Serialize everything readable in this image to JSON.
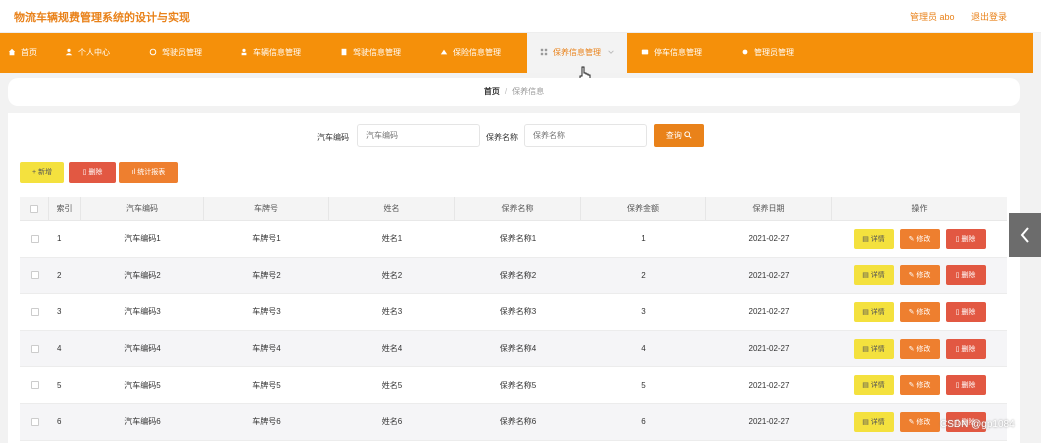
{
  "app": {
    "title": "物流车辆规费管理系统的设计与实现"
  },
  "user": {
    "role_name": "管理员 abo",
    "logout_label": "退出登录"
  },
  "nav": {
    "items": [
      {
        "label": "首页",
        "icon": "home-icon"
      },
      {
        "label": "个人中心",
        "icon": "user-icon"
      },
      {
        "label": "驾驶员管理",
        "icon": "driver-icon"
      },
      {
        "label": "车辆信息管理",
        "icon": "car-icon"
      },
      {
        "label": "驾驶信息管理",
        "icon": "doc-icon"
      },
      {
        "label": "保险信息管理",
        "icon": "insurance-icon"
      },
      {
        "label": "保养信息管理",
        "icon": "grid-icon",
        "active": true
      },
      {
        "label": "停车信息管理",
        "icon": "parking-icon"
      },
      {
        "label": "管理员管理",
        "icon": "admin-icon"
      }
    ]
  },
  "breadcrumb": {
    "home": "首页",
    "separator": "/",
    "current": "保养信息"
  },
  "search": {
    "car_code_label": "汽车编码",
    "car_code_placeholder": "汽车编码",
    "maint_name_label": "保养名称",
    "maint_name_placeholder": "保养名称",
    "query_label": "查询"
  },
  "actions": {
    "add_label": "新增",
    "delete_label": "删除",
    "stats_label": "统计报表"
  },
  "table": {
    "headers": [
      "索引",
      "汽车编码",
      "车牌号",
      "姓名",
      "保养名称",
      "保养金额",
      "保养日期",
      "操作"
    ],
    "rows": [
      {
        "index": "1",
        "car_code": "汽车编码1",
        "plate": "车牌号1",
        "name": "姓名1",
        "maint_name": "保养名称1",
        "amount": "1",
        "date": "2021-02-27"
      },
      {
        "index": "2",
        "car_code": "汽车编码2",
        "plate": "车牌号2",
        "name": "姓名2",
        "maint_name": "保养名称2",
        "amount": "2",
        "date": "2021-02-27"
      },
      {
        "index": "3",
        "car_code": "汽车编码3",
        "plate": "车牌号3",
        "name": "姓名3",
        "maint_name": "保养名称3",
        "amount": "3",
        "date": "2021-02-27"
      },
      {
        "index": "4",
        "car_code": "汽车编码4",
        "plate": "车牌号4",
        "name": "姓名4",
        "maint_name": "保养名称4",
        "amount": "4",
        "date": "2021-02-27"
      },
      {
        "index": "5",
        "car_code": "汽车编码5",
        "plate": "车牌号5",
        "name": "姓名5",
        "maint_name": "保养名称5",
        "amount": "5",
        "date": "2021-02-27"
      },
      {
        "index": "6",
        "car_code": "汽车编码6",
        "plate": "车牌号6",
        "name": "姓名6",
        "maint_name": "保养名称6",
        "amount": "6",
        "date": "2021-02-27"
      }
    ],
    "row_actions": {
      "detail": "详情",
      "edit": "修改",
      "delete": "删除"
    }
  },
  "watermark": "CSDN @gp1084",
  "colors": {
    "accent": "#f5900a",
    "title": "#e9821a",
    "yellow": "#f4e13e",
    "orange": "#ee7f2f",
    "red": "#e25842"
  }
}
